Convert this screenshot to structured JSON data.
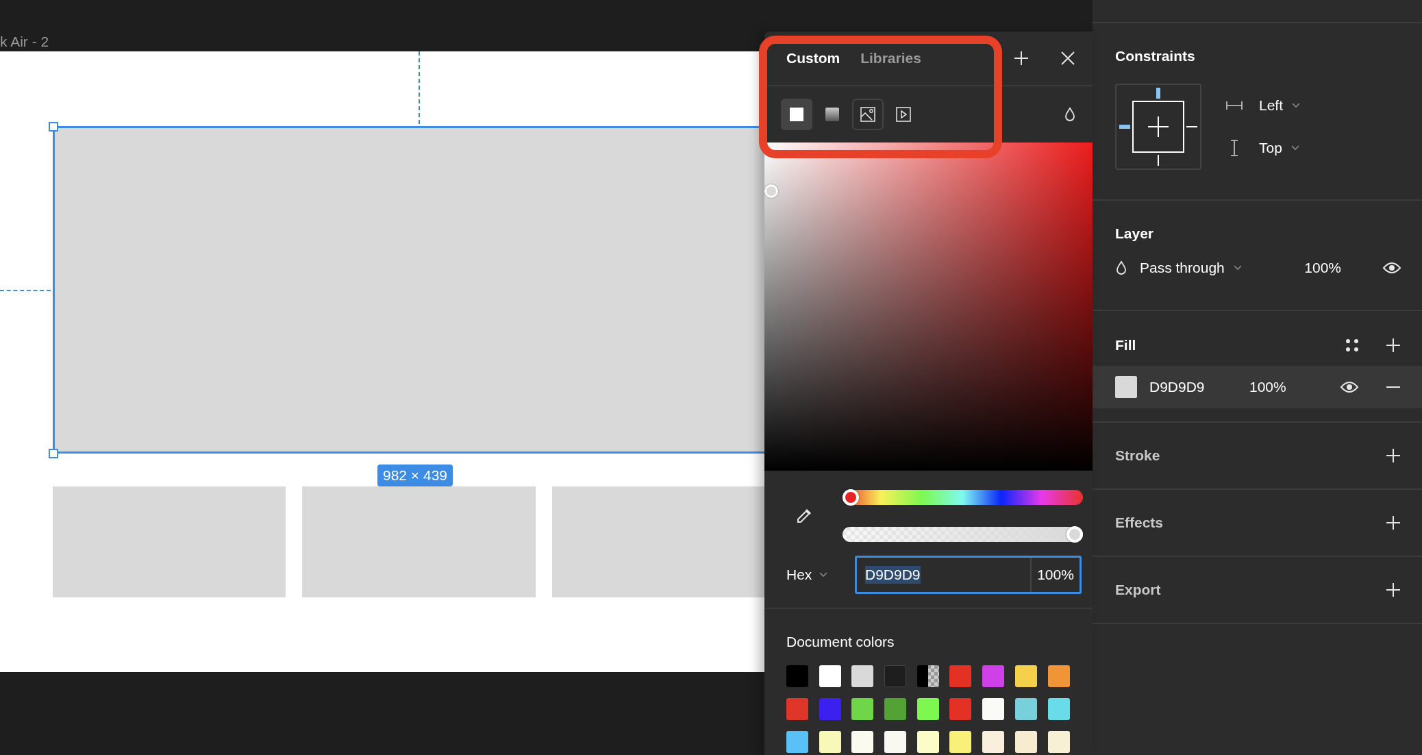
{
  "canvas": {
    "frame_label": "k Air - 2",
    "selection_size": "982 × 439"
  },
  "color_picker": {
    "tabs": [
      {
        "label": "Custom",
        "selected": true
      },
      {
        "label": "Libraries",
        "selected": false
      }
    ],
    "fill_types": [
      {
        "kind": "solid",
        "selected": true,
        "hovered": false
      },
      {
        "kind": "gradient",
        "selected": false,
        "hovered": false
      },
      {
        "kind": "image",
        "selected": false,
        "hovered": true
      },
      {
        "kind": "video",
        "selected": false,
        "hovered": false
      }
    ],
    "hue": {
      "level": 0.0
    },
    "opacity_slider": {
      "level": 1.0
    },
    "color_format": "Hex",
    "hex": "D9D9D9",
    "opacity": "100%",
    "document_colors": {
      "title": "Document colors",
      "swatches": [
        {
          "kind": "solid",
          "color": "#000000"
        },
        {
          "kind": "solid",
          "color": "#ffffff"
        },
        {
          "kind": "solid",
          "color": "#d9d9d9"
        },
        {
          "kind": "solid",
          "color": "#1e1e1e"
        },
        {
          "kind": "partial",
          "color": "#000000"
        },
        {
          "kind": "solid",
          "color": "#e33224"
        },
        {
          "kind": "solid",
          "color": "#d040e8"
        },
        {
          "kind": "solid",
          "color": "#f5d04a"
        },
        {
          "kind": "solid",
          "color": "#ef9538"
        },
        {
          "kind": "solid",
          "color": "#e0362a"
        },
        {
          "kind": "solid",
          "color": "#3b20f0"
        },
        {
          "kind": "solid",
          "color": "#6ed648"
        },
        {
          "kind": "solid",
          "color": "#52a236"
        },
        {
          "kind": "solid",
          "color": "#7ef850"
        },
        {
          "kind": "solid",
          "color": "#e33225"
        },
        {
          "kind": "solid",
          "color": "#fafaf7"
        },
        {
          "kind": "solid",
          "color": "#78d0da"
        },
        {
          "kind": "solid",
          "color": "#68dce8"
        },
        {
          "kind": "solid",
          "color": "#5ac0f8"
        },
        {
          "kind": "solid",
          "color": "#f8f8b8"
        },
        {
          "kind": "solid",
          "color": "#fafaf0"
        },
        {
          "kind": "solid",
          "color": "#f9f9f1"
        },
        {
          "kind": "solid",
          "color": "#fcfcc8"
        },
        {
          "kind": "solid",
          "color": "#f8f078"
        },
        {
          "kind": "solid",
          "color": "#f8f0dc"
        },
        {
          "kind": "solid",
          "color": "#f8ecd0"
        },
        {
          "kind": "solid",
          "color": "#f8f0d4"
        }
      ]
    }
  },
  "design_panel": {
    "constraints": {
      "title": "Constraints",
      "horizontal": "Left",
      "vertical": "Top"
    },
    "layer": {
      "title": "Layer",
      "blend_mode": "Pass through",
      "opacity": "100%",
      "visible": true
    },
    "fill": {
      "title": "Fill",
      "items": [
        {
          "hex": "D9D9D9",
          "opacity": "100%",
          "visible": true
        }
      ]
    },
    "sections": [
      {
        "title": "Stroke"
      },
      {
        "title": "Effects"
      },
      {
        "title": "Export"
      }
    ]
  }
}
